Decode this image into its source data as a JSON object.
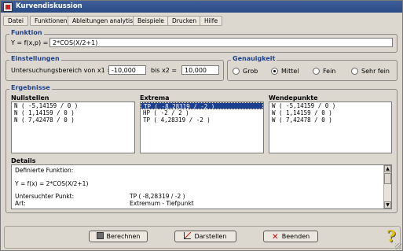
{
  "window": {
    "title": "Kurvendiskussion"
  },
  "menu": [
    "Datei",
    "Funktionen",
    "Ableitungen analytisch",
    "Beispiele",
    "Drucken",
    "Hilfe"
  ],
  "funktion": {
    "group_title": "Funktion",
    "label": "Y = f(x,p) =",
    "value": "2*COS(X/2+1)"
  },
  "einstellungen": {
    "group_title": "Einstellungen",
    "range_label": "Untersuchungsbereich von x1 =",
    "x1": "-10,000",
    "bis_label": "bis x2 =",
    "x2": "10,000"
  },
  "genauigkeit": {
    "group_title": "Genauigkeit",
    "options": [
      "Grob",
      "Mittel",
      "Fein",
      "Sehr fein"
    ],
    "selected": "Mittel"
  },
  "ergebnisse": {
    "group_title": "Ergebnisse",
    "nullstellen": {
      "label": "Nullstellen",
      "items": [
        "N ( -5,14159 / 0 )",
        "N ( 1,14159 / 0 )",
        "N ( 7,42478 / 0 )"
      ]
    },
    "extrema": {
      "label": "Extrema",
      "items": [
        "TP ( -8,28319 / -2 )",
        "HP ( -2 / 2 )",
        "TP ( 4,28319 / -2 )"
      ],
      "selected_index": 0
    },
    "wendepunkte": {
      "label": "Wendepunkte",
      "items": [
        "W ( -5,14159 / 0 )",
        "W ( 1,14159 / 0 )",
        "W ( 7,42478 / 0 )"
      ]
    },
    "details": {
      "label": "Details",
      "definierte": "Definierte Funktion:",
      "funktion_line": "Y = f(x) = 2*COS(X/2+1)",
      "punkt_label": "Untersuchter Punkt:",
      "punkt_value": "TP ( -8,28319 / -2 )",
      "art_label": "Art:",
      "art_value": "Extremum - Tiefpunkt"
    }
  },
  "buttons": {
    "berechnen": "Berechnen",
    "darstellen": "Darstellen",
    "beenden": "Beenden"
  },
  "colors": {
    "group_title": "#1c3f8f",
    "selection": "#1c3f8f",
    "titlebar": "#2a4b86",
    "help_icon": "#e0c200"
  }
}
